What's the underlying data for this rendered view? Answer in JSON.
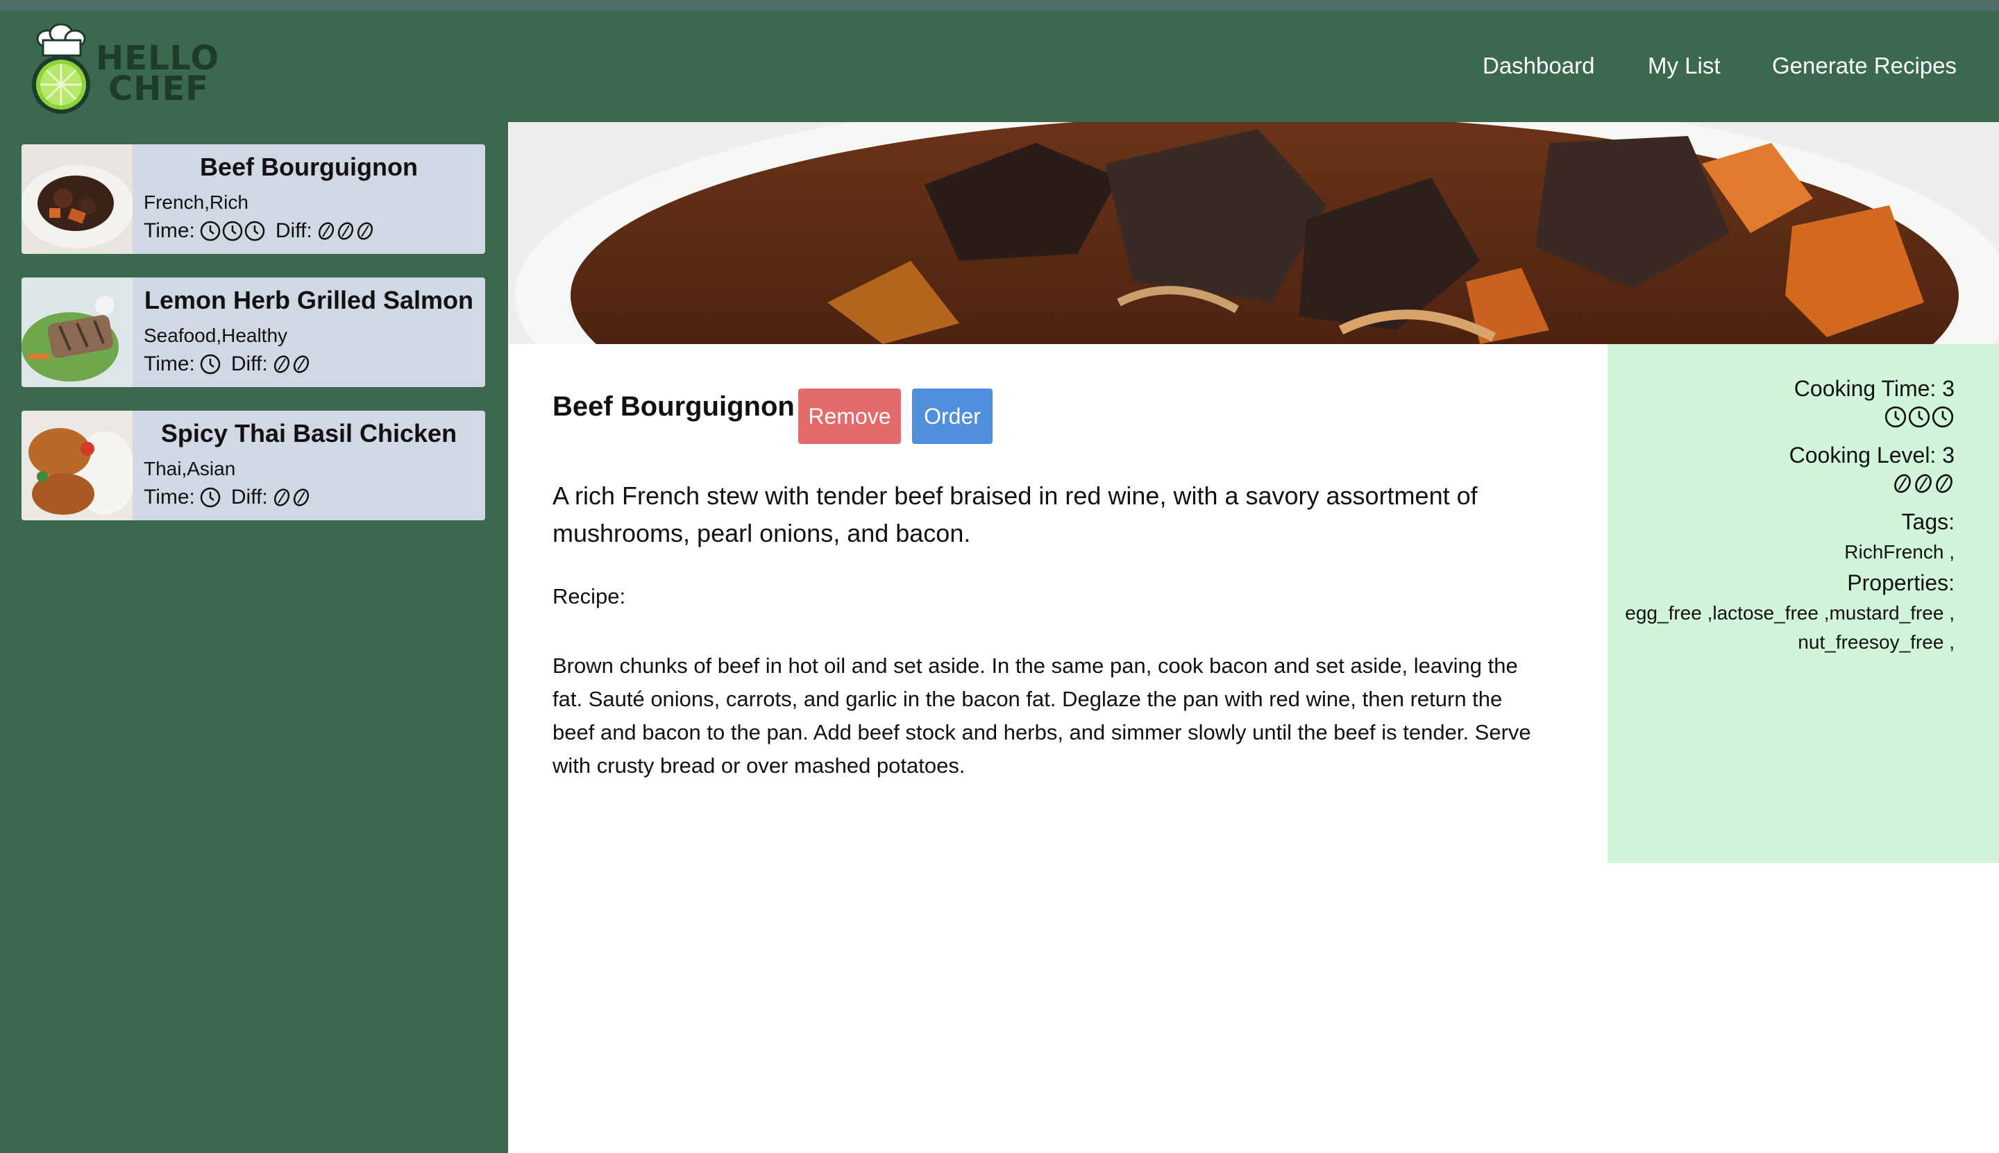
{
  "brand": {
    "line1": "HELLO",
    "line2": "CHEF"
  },
  "nav": {
    "dashboard": "Dashboard",
    "my_list": "My List",
    "generate": "Generate Recipes"
  },
  "sidebar": {
    "items": [
      {
        "title": "Beef Bourguignon",
        "tags": "French,Rich",
        "time_label": "Time:",
        "diff_label": "Diff:",
        "time_level": 3,
        "diff_level": 3
      },
      {
        "title": "Lemon Herb Grilled Salmon",
        "tags": "Seafood,Healthy",
        "time_label": "Time:",
        "diff_label": "Diff:",
        "time_level": 1,
        "diff_level": 2
      },
      {
        "title": "Spicy Thai Basil Chicken",
        "tags": "Thai,Asian",
        "time_label": "Time:",
        "diff_label": "Diff:",
        "time_level": 1,
        "diff_level": 2
      }
    ]
  },
  "detail": {
    "title": "Beef Bourguignon",
    "remove_label": "Remove",
    "order_label": "Order",
    "description": "A rich French stew with tender beef braised in red wine, with a savory assortment of mushrooms, pearl onions, and bacon.",
    "recipe_label": "Recipe:",
    "recipe_text": "Brown chunks of beef in hot oil and set aside. In the same pan, cook bacon and set aside, leaving the fat. Sauté onions, carrots, and garlic in the bacon fat. Deglaze the pan with red wine, then return the beef and bacon to the pan. Add beef stock and herbs, and simmer slowly until the beef is tender. Serve with crusty bread or over mashed potatoes."
  },
  "info": {
    "cooking_time": "Cooking Time: 3",
    "cooking_level": "Cooking Level: 3",
    "time_level": 3,
    "diff_level": 3,
    "tags_label": "Tags:",
    "tags_value": "RichFrench ,",
    "properties_label": "Properties:",
    "properties_line1": "egg_free ,lactose_free ,mustard_free ,",
    "properties_line2": "nut_freesoy_free ,"
  },
  "colors": {
    "header_bg": "#3a694d",
    "card_bg": "#d0d9e3",
    "remove": "#e56b6b",
    "order": "#4f8fdc",
    "info_bg": "#d0f5d8"
  },
  "icons": {
    "time": "clock-icon",
    "difficulty": "leaf-icon"
  }
}
